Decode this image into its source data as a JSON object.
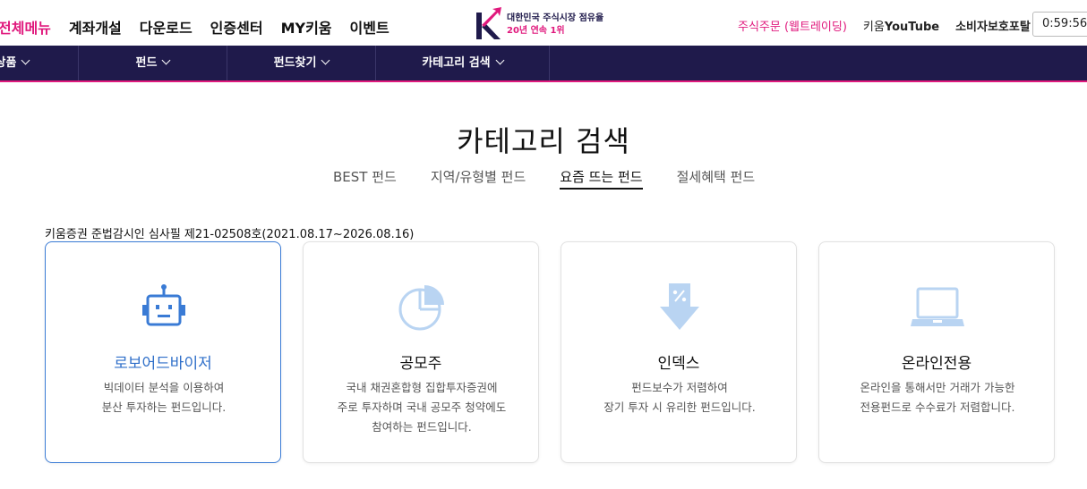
{
  "top_menu": [
    "전체메뉴",
    "계좌개설",
    "다운로드",
    "인증센터",
    "MY키움",
    "이벤트"
  ],
  "logo": {
    "line1": "대한민국 주식시장 점유율",
    "line2": "20년 연속 1위"
  },
  "top_right": {
    "order": "주식주문 (웹트레이딩)",
    "yt_prefix": "키움",
    "yt_brand": "YouTube",
    "consumer": "소비자보호포탈"
  },
  "timer": "0:59:56",
  "nav": [
    "상품",
    "펀드",
    "펀드찾기",
    "카테고리 검색"
  ],
  "page_title": "카테고리 검색",
  "tabs": [
    "BEST 펀드",
    "지역/유형별 펀드",
    "요즘 뜨는 펀드",
    "절세혜택 펀드"
  ],
  "active_tab_index": 2,
  "notice": "키움증권 준법감시인 심사필 제21-02508호(2021.08.17~2026.08.16)",
  "cards": [
    {
      "title": "로보어드바이저",
      "desc": [
        "빅데이터 분석을 이용하여",
        "분산 투자하는 펀드입니다."
      ],
      "icon": "robot-icon"
    },
    {
      "title": "공모주",
      "desc": [
        "국내 채권혼합형 집합투자증권에",
        "주로 투자하며 국내 공모주 청약에도",
        "참여하는 펀드입니다."
      ],
      "icon": "pie-chart-icon"
    },
    {
      "title": "인덱스",
      "desc": [
        "펀드보수가 저렴하여",
        "장기 투자 시 유리한 펀드입니다."
      ],
      "icon": "discount-arrow-icon"
    },
    {
      "title": "온라인전용",
      "desc": [
        "온라인을 통해서만 거래가 가능한",
        "전용펀드로 수수료가 저렴합니다."
      ],
      "icon": "laptop-icon"
    }
  ],
  "colors": {
    "brand_pink": "#e0197d",
    "nav_bg": "#1f1a4b",
    "selected_blue": "#3a7bd5",
    "icon_light_blue": "#b9d4f2"
  }
}
